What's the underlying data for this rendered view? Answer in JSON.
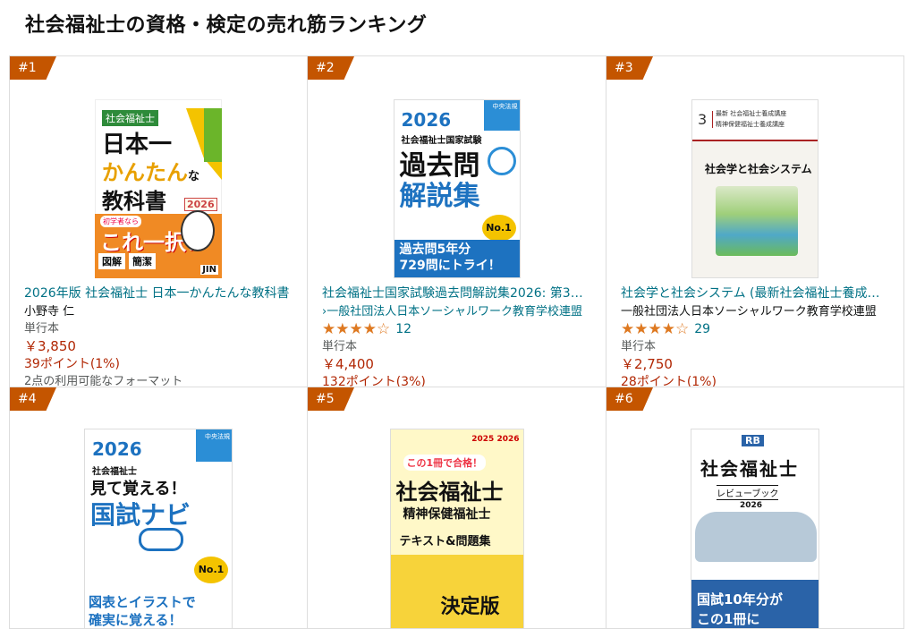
{
  "page": {
    "title": "社会福祉士の資格・検定の売れ筋ランキング"
  },
  "products": [
    {
      "rank": "#1",
      "title": "2026年版 社会福祉士 日本一かんたんな教科書",
      "author": "小野寺 仁",
      "format": "単行本",
      "price": "￥3,850",
      "points": "39ポイント(1%)",
      "other_formats": "2点の利用可能なフォーマット",
      "cover": {
        "badge": "社会福祉士",
        "line1": "日本一",
        "line2": "かんたん",
        "line2_suffix": "な",
        "line3": "教科書",
        "year": "2026",
        "banner": "これ一択！",
        "pill_small": "初学者なら",
        "tag1": "図解",
        "tag2": "簡潔",
        "publisher": "JIN"
      }
    },
    {
      "rank": "#2",
      "title": "社会福祉士国家試験過去問解説集2026: 第3…",
      "author": "›一般社団法人日本ソーシャルワーク教育学校連盟",
      "rating": "★★★★☆",
      "review_count": "12",
      "format": "単行本",
      "price": "￥4,400",
      "points": "132ポイント(3%)",
      "cover": {
        "year": "2026",
        "sub": "社会福祉士国家試験",
        "main1": "過去問",
        "main2": "解説集",
        "tag": "中央法規",
        "no1": "No.1",
        "bottom1": "過去問5年分",
        "bottom2": "729問にトライ！"
      }
    },
    {
      "rank": "#3",
      "title": "社会学と社会システム (最新社会福祉士養成…",
      "author": "一般社団法人日本ソーシャルワーク教育学校連盟",
      "rating": "★★★★☆",
      "review_count": "29",
      "format": "単行本",
      "price": "￥2,750",
      "points": "28ポイント(1%)",
      "cover": {
        "num": "3",
        "series1": "最新 社会福祉士養成講座",
        "series2": "精神保健福祉士養成講座",
        "main": "社会学と社会システム"
      }
    },
    {
      "rank": "#4",
      "cover": {
        "year": "2026",
        "sub": "社会福祉士",
        "main1": "見て覚える！",
        "main2": "国試ナビ",
        "tag": "中央法規",
        "no1": "No.1",
        "bottom1": "図表とイラストで",
        "bottom2": "確実に覚える！"
      }
    },
    {
      "rank": "#5",
      "cover": {
        "top": "この1冊で合格！",
        "main1": "社会福祉士",
        "main2": "精神保健福祉士",
        "main3": "テキスト&問題集",
        "badge": "決定版",
        "years": "2025 2026"
      }
    },
    {
      "rank": "#6",
      "cover": {
        "logo": "RB",
        "main": "社会福祉士",
        "sub": "レビューブック",
        "year": "2026",
        "bottom1": "国試10年分が",
        "bottom2": "この1冊に"
      }
    }
  ]
}
